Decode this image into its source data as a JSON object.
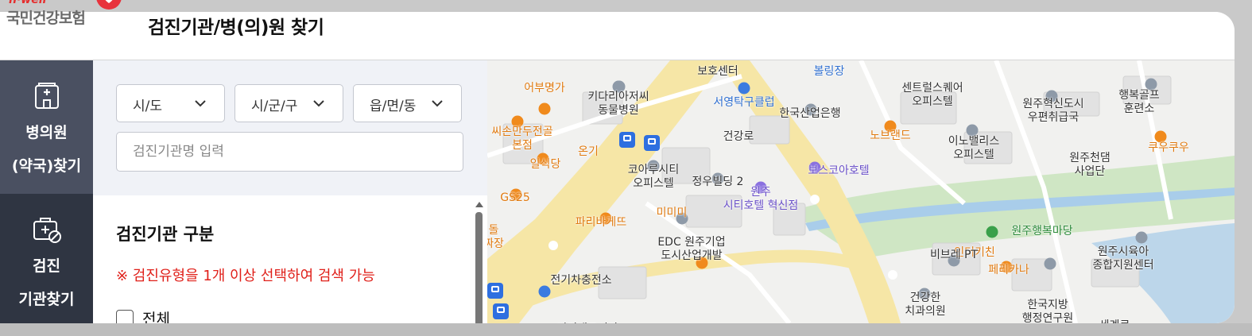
{
  "logo": {
    "sub": "h·well",
    "name": "국민건강보험"
  },
  "page_title": "검진기관/병(의)원 찾기",
  "nav": {
    "items": [
      {
        "label": "병의원\n(약국)찾기",
        "icon": "hospital-icon",
        "active": true
      },
      {
        "label": "검진\n기관찾기",
        "icon": "medical-bag-icon",
        "active": false
      }
    ]
  },
  "filters": {
    "sido": "시/도",
    "sigungu": "시/군/구",
    "eupmyeondong": "읍/면/동",
    "name_placeholder": "검진기관명 입력"
  },
  "section": {
    "title": "검진기관 구분",
    "notice": "※ 검진유형을 1개 이상 선택하여 검색 가능",
    "all_label": "전체"
  },
  "map_labels": [
    {
      "text": "볼링장",
      "style": "blue"
    },
    {
      "text": "보호센터",
      "style": ""
    },
    {
      "text": "어부명가",
      "style": "orange"
    },
    {
      "text": "키다리아저씨\n동물병원",
      "style": ""
    },
    {
      "text": "센트럴스퀘어\n오피스텔",
      "style": ""
    },
    {
      "text": "원주혁신도시\n우편취급국",
      "style": ""
    },
    {
      "text": "행복골프\n훈련소",
      "style": ""
    },
    {
      "text": "서영탁구클럽",
      "style": "blue"
    },
    {
      "text": "한국산업은행",
      "style": ""
    },
    {
      "text": "씨손만두전골\n본점",
      "style": "orange"
    },
    {
      "text": "노브랜드",
      "style": "orange"
    },
    {
      "text": "이노밸리스\n오피스텔",
      "style": ""
    },
    {
      "text": "쿠우쿠우",
      "style": "orange"
    },
    {
      "text": "온기",
      "style": "orange"
    },
    {
      "text": "건강로",
      "style": ""
    },
    {
      "text": "원주천댐\n사업단",
      "style": ""
    },
    {
      "text": "일식당",
      "style": "orange"
    },
    {
      "text": "코아루시티\n오피스텔",
      "style": ""
    },
    {
      "text": "정우빌딩 2",
      "style": ""
    },
    {
      "text": "보스코아호텔",
      "style": "purple"
    },
    {
      "text": "GS25",
      "style": "orange"
    },
    {
      "text": "원주\n시티호텔 혁신점",
      "style": "purple"
    },
    {
      "text": "미미미",
      "style": "orange"
    },
    {
      "text": "파리바게뜨",
      "style": "orange"
    },
    {
      "text": "원주행복마당",
      "style": "green"
    },
    {
      "text": "돌\n짜장",
      "style": "orange"
    },
    {
      "text": "EDC 원주기업\n도시산업개발",
      "style": ""
    },
    {
      "text": "인더키친",
      "style": "orange"
    },
    {
      "text": "비브레 PT",
      "style": ""
    },
    {
      "text": "원주시육아\n종합지원센터",
      "style": ""
    },
    {
      "text": "페리카나",
      "style": "orange"
    },
    {
      "text": "전기차충전소",
      "style": ""
    },
    {
      "text": "건강한\n치과의원",
      "style": ""
    },
    {
      "text": "한국지방\n행정연구원",
      "style": ""
    },
    {
      "text": "미리내도서관",
      "style": ""
    },
    {
      "text": "세계로",
      "style": ""
    }
  ]
}
